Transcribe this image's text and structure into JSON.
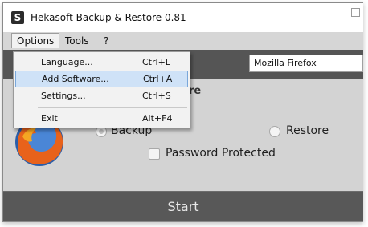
{
  "window": {
    "title": "Hekasoft Backup & Restore 0.81",
    "icon": "hekasoft-logo-icon"
  },
  "menubar": {
    "items": [
      "Options",
      "Tools",
      "?"
    ]
  },
  "options_menu": {
    "items": [
      {
        "label": "Language...",
        "shortcut": "Ctrl+L"
      },
      {
        "label": "Add Software...",
        "shortcut": "Ctrl+A"
      },
      {
        "label": "Settings...",
        "shortcut": "Ctrl+S"
      },
      {
        "label": "Exit",
        "shortcut": "Alt+F4"
      }
    ],
    "highlighted_index": 1
  },
  "software_select": {
    "value": "Mozilla Firefox"
  },
  "panel": {
    "heading_fragment": "ore",
    "backup_label": "Backup",
    "restore_label": "Restore",
    "password_label": "Password Protected",
    "selected_mode": "Backup",
    "password_protected": false
  },
  "actions": {
    "start_label": "Start"
  },
  "colors": {
    "menubar": "#d6d6d6",
    "panel": "#d3d3d3",
    "start_bar": "#585858",
    "highlight": "#cfe2f7"
  }
}
